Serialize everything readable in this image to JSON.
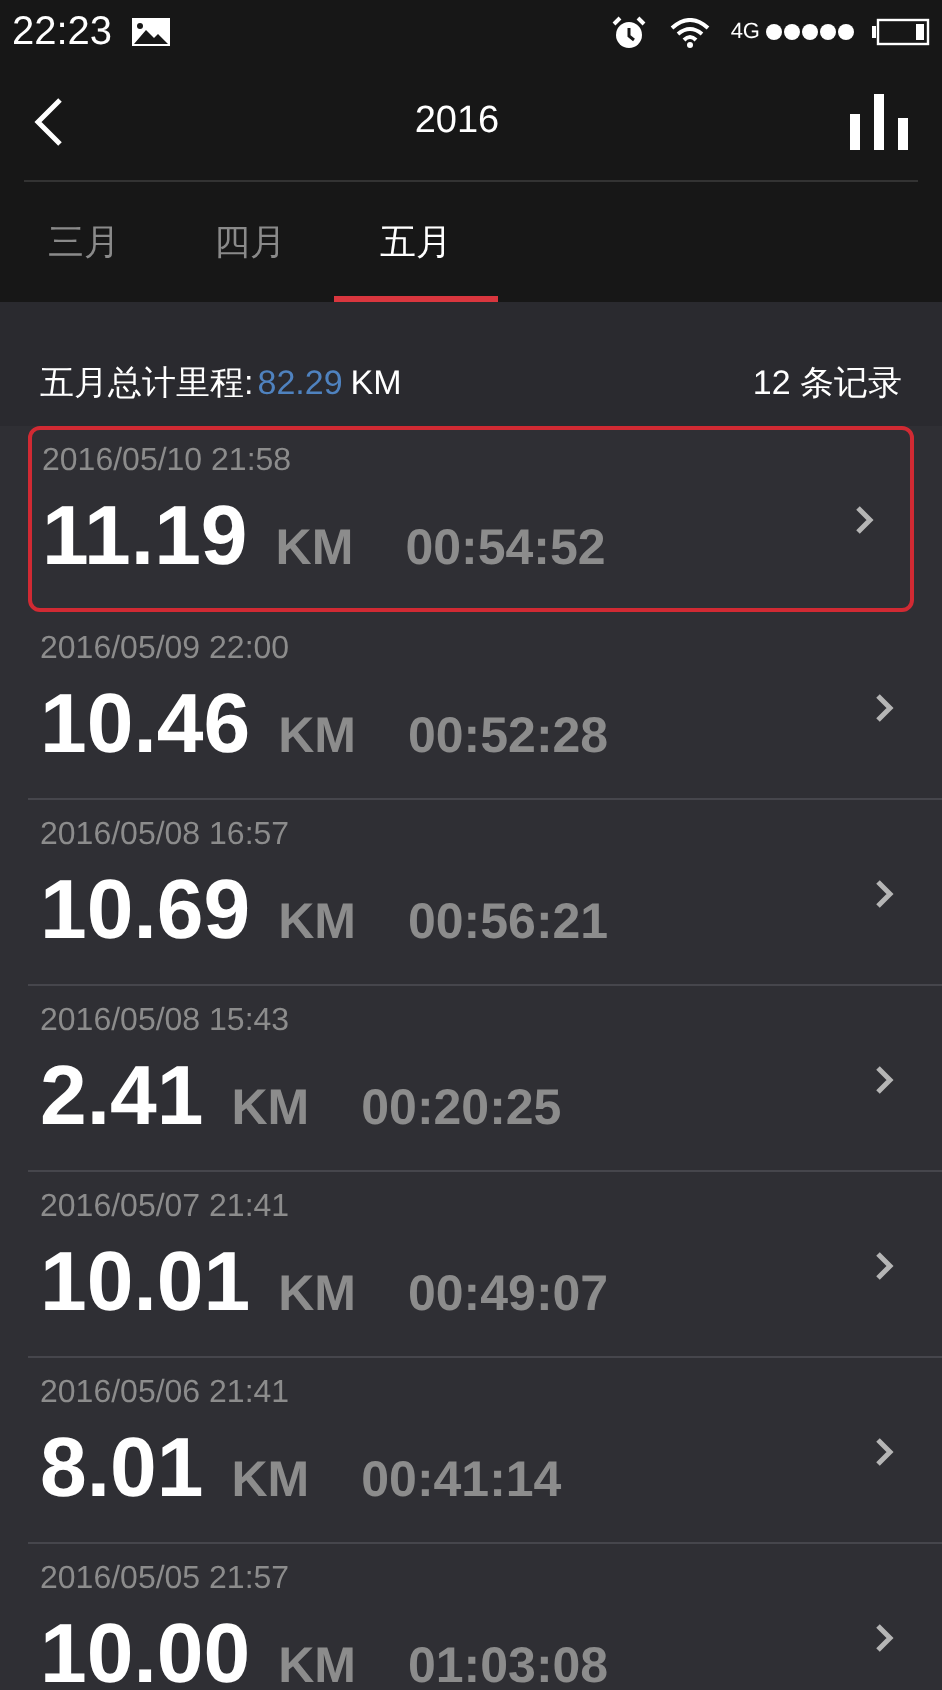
{
  "status_bar": {
    "time": "22:23",
    "network": "4G"
  },
  "header": {
    "title": "2016"
  },
  "tabs": [
    {
      "label": "三月",
      "selected": false
    },
    {
      "label": "四月",
      "selected": false
    },
    {
      "label": "五月",
      "selected": true
    }
  ],
  "summary": {
    "label": "五月总计里程:",
    "distance": "82.29",
    "unit": "KM",
    "count": "12 条记录"
  },
  "records": [
    {
      "date": "2016/05/10 21:58",
      "distance": "11.19",
      "unit": "KM",
      "duration": "00:54:52",
      "selected": true
    },
    {
      "date": "2016/05/09 22:00",
      "distance": "10.46",
      "unit": "KM",
      "duration": "00:52:28",
      "selected": false
    },
    {
      "date": "2016/05/08 16:57",
      "distance": "10.69",
      "unit": "KM",
      "duration": "00:56:21",
      "selected": false
    },
    {
      "date": "2016/05/08 15:43",
      "distance": "2.41",
      "unit": "KM",
      "duration": "00:20:25",
      "selected": false
    },
    {
      "date": "2016/05/07 21:41",
      "distance": "10.01",
      "unit": "KM",
      "duration": "00:49:07",
      "selected": false
    },
    {
      "date": "2016/05/06 21:41",
      "distance": "8.01",
      "unit": "KM",
      "duration": "00:41:14",
      "selected": false
    },
    {
      "date": "2016/05/05 21:57",
      "distance": "10.00",
      "unit": "KM",
      "duration": "01:03:08",
      "selected": false
    }
  ]
}
